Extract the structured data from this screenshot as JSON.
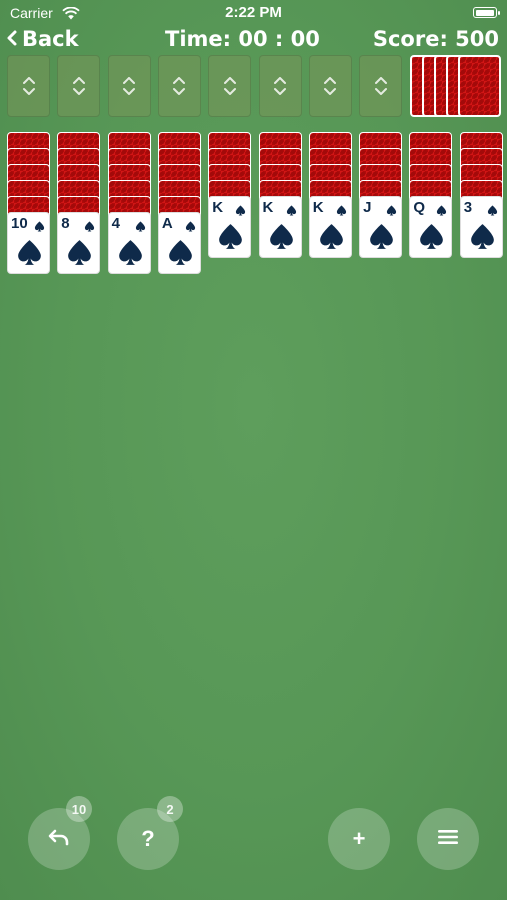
{
  "status_bar": {
    "carrier": "Carrier",
    "time": "2:22 PM",
    "battery_level": 1.0
  },
  "header": {
    "back_label": "Back",
    "time_label": "Time: 00 : 00",
    "score_label": "Score: 500"
  },
  "foundations": {
    "count": 8,
    "icon": "chevron-up-down-icon"
  },
  "stock": {
    "piles": 5,
    "card_back_color": "#d11616"
  },
  "tableau": {
    "columns": [
      {
        "facedown": 5,
        "rank": "10",
        "suit": "spades"
      },
      {
        "facedown": 5,
        "rank": "8",
        "suit": "spades"
      },
      {
        "facedown": 5,
        "rank": "4",
        "suit": "spades"
      },
      {
        "facedown": 5,
        "rank": "A",
        "suit": "spades"
      },
      {
        "facedown": 4,
        "rank": "K",
        "suit": "spades"
      },
      {
        "facedown": 4,
        "rank": "K",
        "suit": "spades"
      },
      {
        "facedown": 4,
        "rank": "K",
        "suit": "spades"
      },
      {
        "facedown": 4,
        "rank": "J",
        "suit": "spades"
      },
      {
        "facedown": 4,
        "rank": "Q",
        "suit": "spades"
      },
      {
        "facedown": 4,
        "rank": "3",
        "suit": "spades"
      }
    ]
  },
  "controls": {
    "undo": {
      "icon": "undo-icon",
      "badge": "10"
    },
    "hint": {
      "label": "?",
      "badge": "2"
    },
    "deal": {
      "label": "+",
      "icon": "plus-icon"
    },
    "menu": {
      "icon": "menu-icon"
    }
  },
  "colors": {
    "felt": "#579756",
    "card_ink": "#0f2a4a",
    "card_back": "#d11616"
  }
}
